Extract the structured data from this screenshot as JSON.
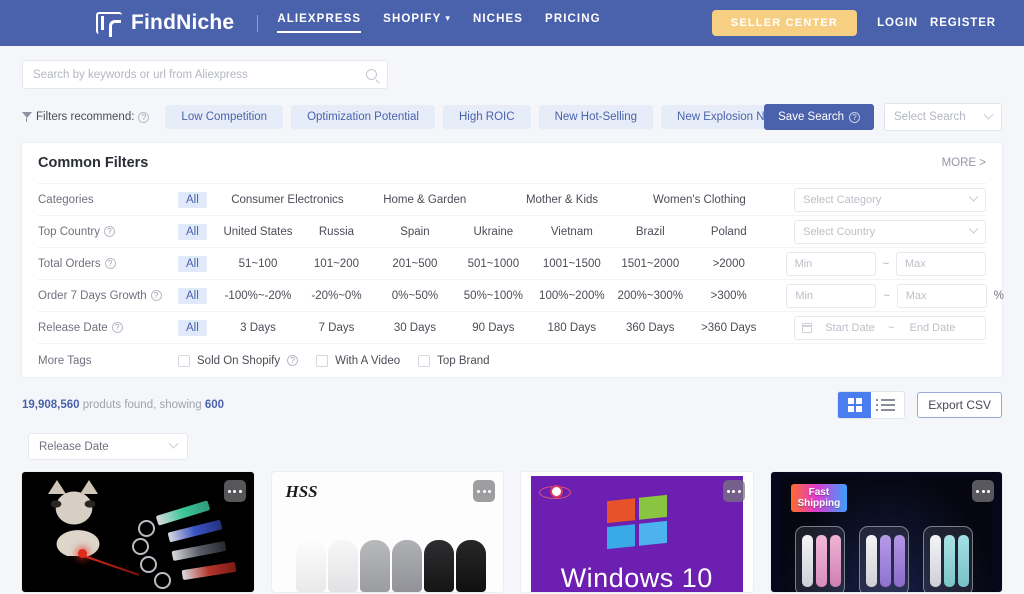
{
  "header": {
    "brand": "FindNiche",
    "brand_icon": "findniche-logo-icon",
    "nav": [
      {
        "label": "ALIEXPRESS",
        "active": true,
        "caret": false
      },
      {
        "label": "SHOPIFY",
        "active": false,
        "caret": true
      },
      {
        "label": "NICHES",
        "active": false,
        "caret": false
      },
      {
        "label": "PRICING",
        "active": false,
        "caret": false
      }
    ],
    "seller_center": "SELLER CENTER",
    "login": "LOGIN",
    "register": "REGISTER",
    "brand_bg": "#4a62ac",
    "seller_bg": "#f6cf82"
  },
  "search": {
    "placeholder": "Search by keywords or url from Aliexpress",
    "value": "",
    "icon": "search-icon"
  },
  "recommend": {
    "label": "Filters recommend:",
    "funnel_icon": "funnel-icon",
    "help_icon": "question-mark-icon",
    "chips": [
      "Low Competition",
      "Optimization Potential",
      "High ROIC",
      "New Hot-Selling",
      "New Explosion Niche"
    ],
    "save_search": "Save Search",
    "select_search_placeholder": "Select Search"
  },
  "filters": {
    "title": "Common Filters",
    "more": "MORE >",
    "rows": [
      {
        "label": "Categories",
        "help": false,
        "all": "All",
        "options": [
          "Consumer Electronics",
          "Home & Garden",
          "Mother & Kids",
          "Women's Clothing"
        ],
        "control": "select",
        "placeholder": "Select Category"
      },
      {
        "label": "Top Country",
        "help": true,
        "all": "All",
        "options": [
          "United States",
          "Russia",
          "Spain",
          "Ukraine",
          "Vietnam",
          "Brazil",
          "Poland"
        ],
        "control": "select",
        "placeholder": "Select Country"
      },
      {
        "label": "Total Orders",
        "help": true,
        "all": "All",
        "options": [
          "51~100",
          "101~200",
          "201~500",
          "501~1000",
          "1001~1500",
          "1501~2000",
          ">2000"
        ],
        "control": "minmax",
        "min_placeholder": "Min",
        "max_placeholder": "Max",
        "separator": "~",
        "suffix": ""
      },
      {
        "label": "Order 7 Days Growth",
        "help": true,
        "all": "All",
        "options": [
          "-100%~-20%",
          "-20%~0%",
          "0%~50%",
          "50%~100%",
          "100%~200%",
          "200%~300%",
          ">300%"
        ],
        "control": "minmax",
        "min_placeholder": "Min",
        "max_placeholder": "Max",
        "separator": "~",
        "suffix": "%"
      },
      {
        "label": "Release Date",
        "help": true,
        "all": "All",
        "options": [
          "3 Days",
          "7 Days",
          "30 Days",
          "90 Days",
          "180 Days",
          "360 Days",
          ">360 Days"
        ],
        "control": "daterange",
        "start_placeholder": "Start Date",
        "end_placeholder": "End Date",
        "separator": "~",
        "calendar_icon": "calendar-icon"
      }
    ],
    "more_tags_label": "More Tags",
    "tags": [
      {
        "label": "Sold On Shopify",
        "help": true,
        "checked": false
      },
      {
        "label": "With A Video",
        "help": false,
        "checked": false
      },
      {
        "label": "Top Brand",
        "help": false,
        "checked": false
      }
    ]
  },
  "results": {
    "count": "19,908,560",
    "count_text": "produts found, showing",
    "showing": "600",
    "grid_icon": "grid-view-icon",
    "list_icon": "list-view-icon",
    "export_label": "Export CSV",
    "sort_value": "Release Date",
    "active_view": "grid"
  },
  "products": [
    {
      "name": "cat-laser-pointer-keychain",
      "alt": "Cat with laser pointer keychains on black background",
      "menu_icon": "more-options-icon"
    },
    {
      "name": "ankle-socks-hss",
      "alt": "White, grey and black ankle socks with HSS logo",
      "logo_text": "HSS",
      "menu_icon": "more-options-icon"
    },
    {
      "name": "windows-10-software",
      "alt": "Windows 10 logo on purple background",
      "title": "Windows 10",
      "menu_icon": "more-options-icon"
    },
    {
      "name": "earbud-cleaning-kit",
      "alt": "Transparent cases with cleaning tools, dark background",
      "badge": "Fast\nShipping",
      "badge_line1": "Fast",
      "badge_line2": "Shipping",
      "menu_icon": "more-options-icon"
    }
  ]
}
